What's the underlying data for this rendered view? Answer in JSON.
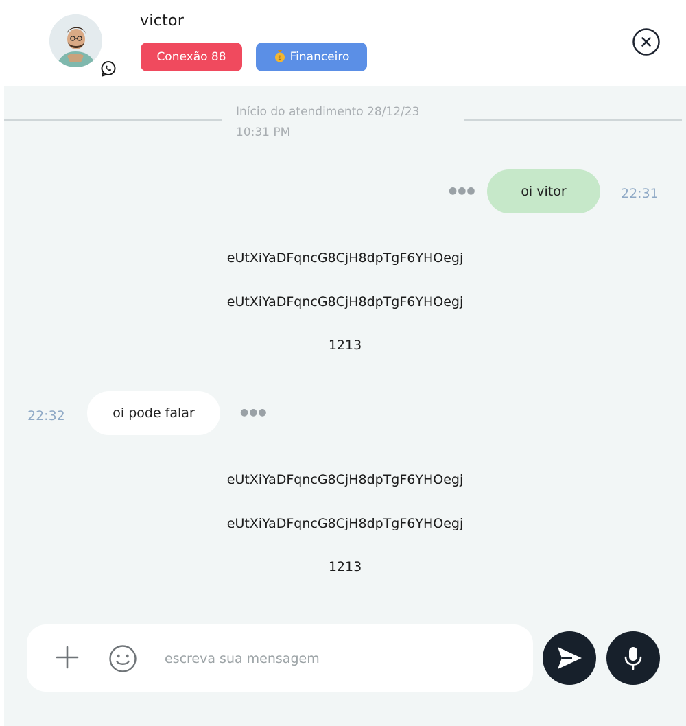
{
  "header": {
    "contact_name": "victor",
    "tags": {
      "connection": {
        "label": "Conexão 88",
        "color": "#f04a5e"
      },
      "department": {
        "label": "Financeiro",
        "icon": "money-bag-icon",
        "color": "#5b8fe6"
      }
    },
    "channel_icon": "whatsapp-icon",
    "close_icon": "close-circle-icon"
  },
  "chat": {
    "divider": {
      "line1": "Início do atendimento 28/12/23",
      "line2": "10:31 PM"
    },
    "messages": [
      {
        "direction": "outgoing",
        "text": "oi vitor",
        "time": "22:31"
      },
      {
        "direction": "incoming",
        "text": "oi pode falar",
        "time": "22:32"
      }
    ],
    "system_blocks": [
      [
        "eUtXiYaDFqncG8CjH8dpTgF6YHOegj",
        "eUtXiYaDFqncG8CjH8dpTgF6YHOegj",
        "1213"
      ],
      [
        "eUtXiYaDFqncG8CjH8dpTgF6YHOegj",
        "eUtXiYaDFqncG8CjH8dpTgF6YHOegj",
        "1213"
      ]
    ],
    "more_icon": "ellipsis-icon"
  },
  "composer": {
    "placeholder": "escreva sua mensagem",
    "value": "",
    "attach_icon": "plus-icon",
    "emoji_icon": "smiley-icon",
    "send_icon": "send-icon",
    "mic_icon": "microphone-icon"
  },
  "colors": {
    "outgoing_bubble": "#c6e8c9",
    "incoming_bubble": "#ffffff",
    "chat_background": "#f2f6f6",
    "timestamp": "#8fa9c6",
    "action_button": "#17202b"
  }
}
